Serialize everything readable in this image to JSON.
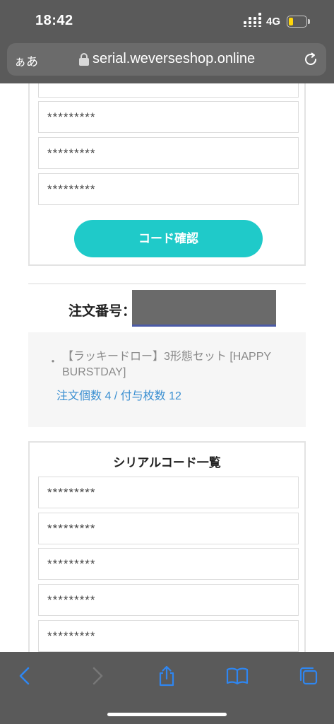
{
  "status_bar": {
    "time": "18:42",
    "network": "4G"
  },
  "browser": {
    "text_size_label": "ぁあ",
    "url": "serial.weverseshop.online"
  },
  "top_panel": {
    "codes": [
      "*********",
      "*********",
      "*********",
      "*********"
    ],
    "confirm_label": "コード確認"
  },
  "order": {
    "label": "注文番号：",
    "bullet": "・",
    "product_name": "【ラッキードロー】3形態セット [HAPPY BURSTDAY]",
    "stats": "注文個数 4 / 付与枚数 12"
  },
  "serial_list": {
    "title": "シリアルコード一覧",
    "codes": [
      "*********",
      "*********",
      "*********",
      "*********",
      "*********"
    ]
  },
  "colors": {
    "accent": "#1fcac9",
    "link": "#3a8fd1",
    "toolbar_icon": "#2f86f0",
    "chrome": "#5a5a5a"
  },
  "toolbar": {
    "icons": [
      "back-icon",
      "forward-icon",
      "share-icon",
      "bookmarks-icon",
      "tabs-icon"
    ]
  }
}
